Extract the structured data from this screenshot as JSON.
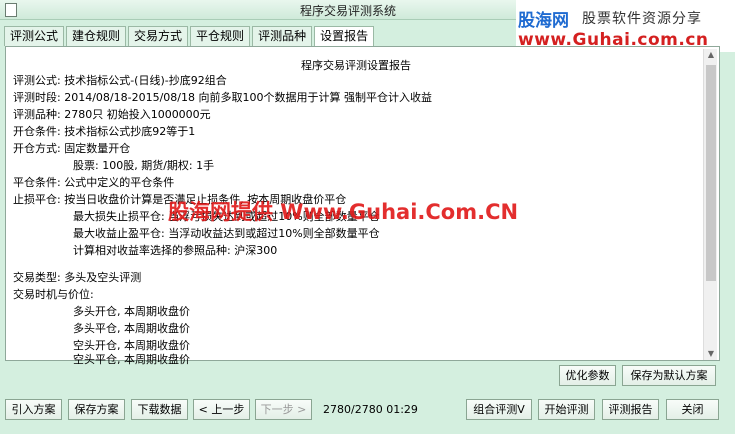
{
  "window": {
    "title": "程序交易评测系统"
  },
  "brand": {
    "name": "股海网",
    "slogan": "股票软件资源分享",
    "url": "www.Guhai.com.cn"
  },
  "tabs": [
    {
      "label": "评测公式"
    },
    {
      "label": "建仓规则"
    },
    {
      "label": "交易方式"
    },
    {
      "label": "平仓规则"
    },
    {
      "label": "评测品种"
    },
    {
      "label": "设置报告"
    }
  ],
  "report": {
    "title": "程序交易评测设置报告",
    "lines": [
      "评测公式: 技术指标公式-(日线)-抄底92组合",
      "评测时段: 2014/08/18-2015/08/18 向前多取100个数据用于计算 强制平仓计入收益",
      "评测品种: 2780只 初始投入1000000元",
      "开仓条件: 技术指标公式抄底92等于1",
      "开仓方式: 固定数量开仓",
      "股票: 100股, 期货/期权: 1手",
      "平仓条件: 公式中定义的平仓条件",
      "止损平仓: 按当日收盘价计算是否满足止损条件, 按本周期收盘价平仓",
      "最大损失止损平仓: 当浮亏损失达到或超过10%则全部数量平仓",
      "最大收益止盈平仓: 当浮动收益达到或超过10%则全部数量平仓",
      "计算相对收益率选择的参照品种: 沪深300",
      "交易类型: 多头及空头评测",
      "交易时机与价位:",
      "多头开仓, 本周期收盘价",
      "多头平仓, 本周期收盘价",
      "空头开仓, 本周期收盘价",
      "空头平仓, 本周期收盘价"
    ]
  },
  "watermark": "股海网提供 Www.Guhai.Com.CN",
  "buttons": {
    "optimize": "优化参数",
    "save_default": "保存为默认方案",
    "import": "引入方案",
    "save": "保存方案",
    "download": "下载数据",
    "prev": "上一步",
    "next": "下一步",
    "combo_eval": "组合评测V",
    "start_eval": "开始评测",
    "eval_report": "评测报告",
    "close": "关闭"
  },
  "status": {
    "progress": "2780/2780",
    "time": "01:29"
  }
}
